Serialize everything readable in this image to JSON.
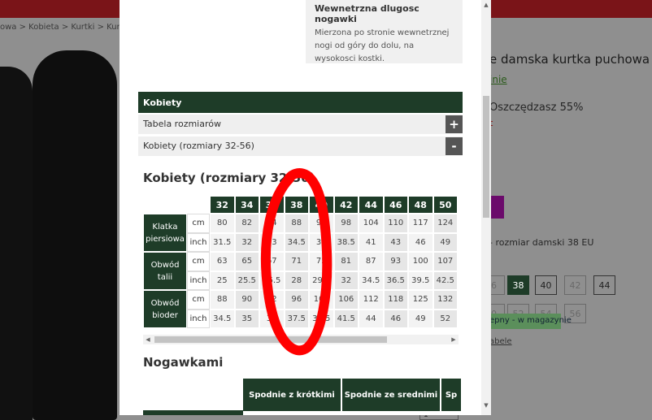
{
  "background": {
    "breadcrumb": "owa > Kobieta > Kurtki > Kurtki p",
    "product_title": "e damska kurtka puchowa",
    "link": "inie",
    "savings": "Oszczędzasz 55%",
    "price_fragment": "t",
    "size_label": "- rozmiar damski 38 EU",
    "sizes_row1": [
      "6",
      "38",
      "40",
      "42",
      "44"
    ],
    "sizes_row2": [
      "0",
      "52",
      "54",
      "56"
    ],
    "stock": "epny - w magazynie",
    "table_link": "abele",
    "qty": "1"
  },
  "modal": {
    "info": {
      "title": "Wewnetrzna dlugosc nogawki",
      "text": "Mierzona po stronie wewnetrznej nogi od góry do dolu, na wysokosci kostki."
    },
    "section": "Kobiety",
    "accordion": [
      {
        "label": "Tabela rozmiarów",
        "toggle": "+"
      },
      {
        "label": "Kobiety (rozmiary 32-56)",
        "toggle": "-"
      }
    ],
    "sizes_heading": "Kobiety (rozmiary 32-56)",
    "table": {
      "sizes": [
        "32",
        "34",
        "36",
        "38",
        "40",
        "42",
        "44",
        "46",
        "48",
        "50"
      ],
      "groups": [
        {
          "label": "Klatka piersiowa",
          "rows": [
            {
              "unit": "cm",
              "values": [
                "80",
                "82",
                "84",
                "88",
                "92",
                "98",
                "104",
                "110",
                "117",
                "124"
              ]
            },
            {
              "unit": "inch",
              "values": [
                "31.5",
                "32",
                "33",
                "34.5",
                "36",
                "38.5",
                "41",
                "43",
                "46",
                "49"
              ]
            }
          ]
        },
        {
          "label": "Obwód talii",
          "rows": [
            {
              "unit": "cm",
              "values": [
                "63",
                "65",
                "67",
                "71",
                "75",
                "81",
                "87",
                "93",
                "100",
                "107"
              ]
            },
            {
              "unit": "inch",
              "values": [
                "25",
                "25.5",
                "26.5",
                "28",
                "29.5",
                "32",
                "34.5",
                "36.5",
                "39.5",
                "42.5"
              ]
            }
          ]
        },
        {
          "label": "Obwód bioder",
          "rows": [
            {
              "unit": "cm",
              "values": [
                "88",
                "90",
                "92",
                "96",
                "100",
                "106",
                "112",
                "118",
                "125",
                "132"
              ]
            },
            {
              "unit": "inch",
              "values": [
                "34.5",
                "35",
                "36",
                "37.5",
                "39.5",
                "41.5",
                "44",
                "46",
                "49",
                "52"
              ]
            }
          ]
        }
      ]
    },
    "nog_heading": "Nogawkami",
    "nog_columns": [
      "Spodnie z krótkimi",
      "Spodnie ze srednimi",
      "Sp"
    ]
  },
  "colors": {
    "accent": "#1e3c28",
    "annotation": "#ff0000"
  }
}
